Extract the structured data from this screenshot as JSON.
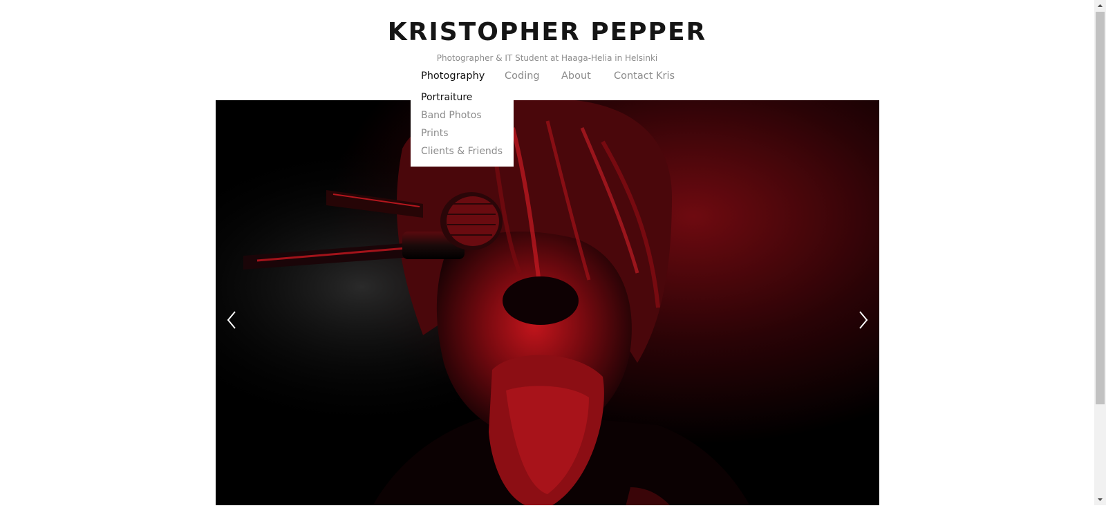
{
  "site": {
    "title": "KRISTOPHER PEPPER",
    "tagline": "Photographer & IT Student at Haaga-Helia in Helsinki"
  },
  "nav": {
    "items": [
      {
        "label": "Photography",
        "active": true
      },
      {
        "label": "Coding"
      },
      {
        "label": "About"
      },
      {
        "label": "Contact Kris"
      }
    ]
  },
  "dropdown": {
    "items": [
      {
        "label": "Portraiture",
        "active": true
      },
      {
        "label": "Band Photos"
      },
      {
        "label": "Prints"
      },
      {
        "label": "Clients & Friends"
      }
    ]
  },
  "slideshow": {
    "photo_subject": "red-lit-singer-at-microphone",
    "colors": {
      "background": "#000000",
      "accent": "#d1171f"
    }
  },
  "icons": {
    "prev": "chevron-left-icon",
    "next": "chevron-right-icon"
  }
}
